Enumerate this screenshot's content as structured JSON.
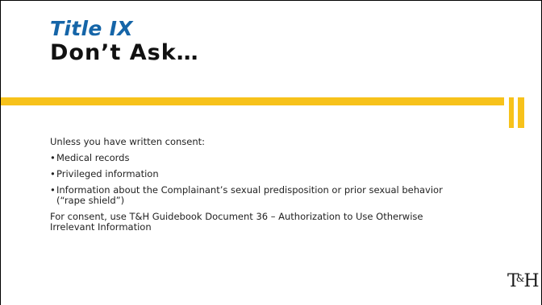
{
  "slide": {
    "subtitle": "Title IX",
    "title": "Don’t Ask…",
    "accent_color": "#f7c21b",
    "subtitle_color": "#1565a8",
    "content": {
      "intro": "Unless you have written consent:",
      "bullets": [
        "Medical records",
        "Privileged information",
        "Information about the Complainant’s sexual predisposition or prior sexual behavior (“rape shield”)"
      ],
      "bullet_symbol": "•",
      "closing": "For consent, use T&H Guidebook Document 36 – Authorization to Use Otherwise Irrelevant Information"
    },
    "logo": {
      "t": "T",
      "amp": "&",
      "h": "H"
    }
  }
}
